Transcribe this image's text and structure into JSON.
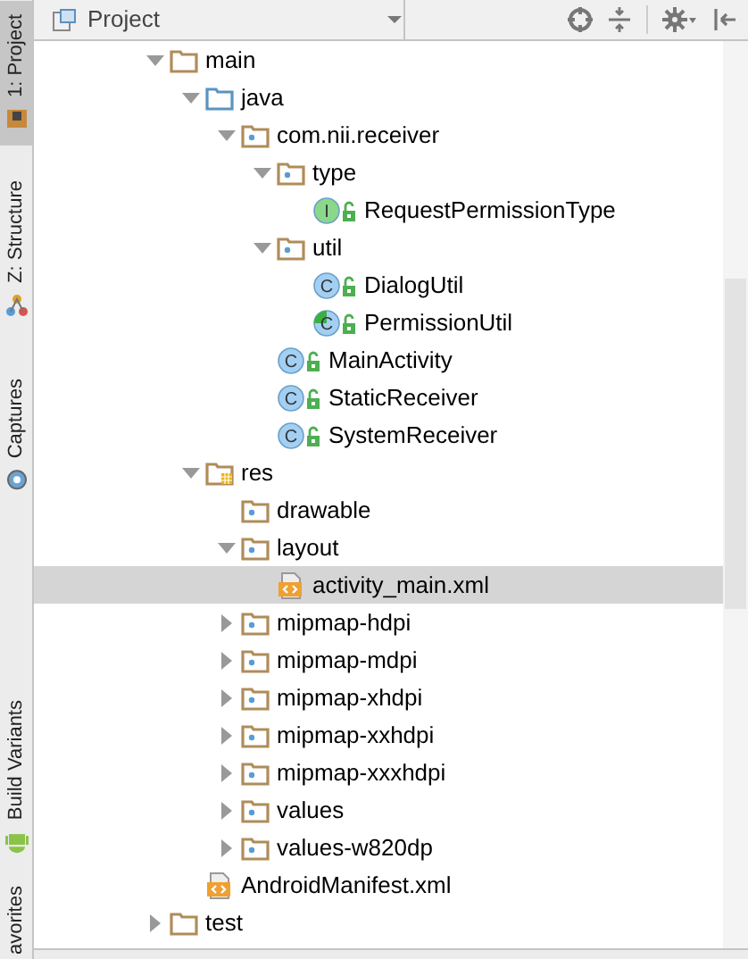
{
  "side_tabs": [
    {
      "label": "1: Project",
      "selected": true
    },
    {
      "label": "Z: Structure",
      "selected": false
    },
    {
      "label": "Captures",
      "selected": false
    },
    {
      "label": "Build Variants",
      "selected": false
    },
    {
      "label": "avorites",
      "selected": false
    }
  ],
  "panel": {
    "title": "Project"
  },
  "tree": [
    {
      "name": "main",
      "kind": "folder",
      "expanded": true,
      "selected": false,
      "children": [
        {
          "name": "java",
          "kind": "source-folder",
          "expanded": true,
          "selected": false,
          "children": [
            {
              "name": "com.nii.receiver",
              "kind": "package",
              "expanded": true,
              "selected": false,
              "children": [
                {
                  "name": "type",
                  "kind": "package",
                  "expanded": true,
                  "selected": false,
                  "children": [
                    {
                      "name": "RequestPermissionType",
                      "kind": "interface",
                      "badge": "I",
                      "selected": false
                    }
                  ]
                },
                {
                  "name": "util",
                  "kind": "package",
                  "expanded": true,
                  "selected": false,
                  "children": [
                    {
                      "name": "DialogUtil",
                      "kind": "class",
                      "badge": "C",
                      "selected": false
                    },
                    {
                      "name": "PermissionUtil",
                      "kind": "class-partial",
                      "badge": "C",
                      "selected": false
                    }
                  ]
                },
                {
                  "name": "MainActivity",
                  "kind": "class",
                  "badge": "C",
                  "selected": false
                },
                {
                  "name": "StaticReceiver",
                  "kind": "class",
                  "badge": "C",
                  "selected": false
                },
                {
                  "name": "SystemReceiver",
                  "kind": "class",
                  "badge": "C",
                  "selected": false
                }
              ]
            }
          ]
        },
        {
          "name": "res",
          "kind": "res-folder",
          "expanded": true,
          "selected": false,
          "children": [
            {
              "name": "drawable",
              "kind": "package",
              "selected": false
            },
            {
              "name": "layout",
              "kind": "package",
              "expanded": true,
              "selected": false,
              "children": [
                {
                  "name": "activity_main.xml",
                  "kind": "xml",
                  "selected": true
                }
              ]
            },
            {
              "name": "mipmap-hdpi",
              "kind": "package",
              "expanded": false,
              "selected": false
            },
            {
              "name": "mipmap-mdpi",
              "kind": "package",
              "expanded": false,
              "selected": false
            },
            {
              "name": "mipmap-xhdpi",
              "kind": "package",
              "expanded": false,
              "selected": false
            },
            {
              "name": "mipmap-xxhdpi",
              "kind": "package",
              "expanded": false,
              "selected": false
            },
            {
              "name": "mipmap-xxxhdpi",
              "kind": "package",
              "expanded": false,
              "selected": false
            },
            {
              "name": "values",
              "kind": "package",
              "expanded": false,
              "selected": false
            },
            {
              "name": "values-w820dp",
              "kind": "package",
              "expanded": false,
              "selected": false
            }
          ]
        },
        {
          "name": "AndroidManifest.xml",
          "kind": "xml",
          "selected": false
        }
      ]
    },
    {
      "name": "test",
      "kind": "folder",
      "expanded": false,
      "selected": false
    }
  ]
}
